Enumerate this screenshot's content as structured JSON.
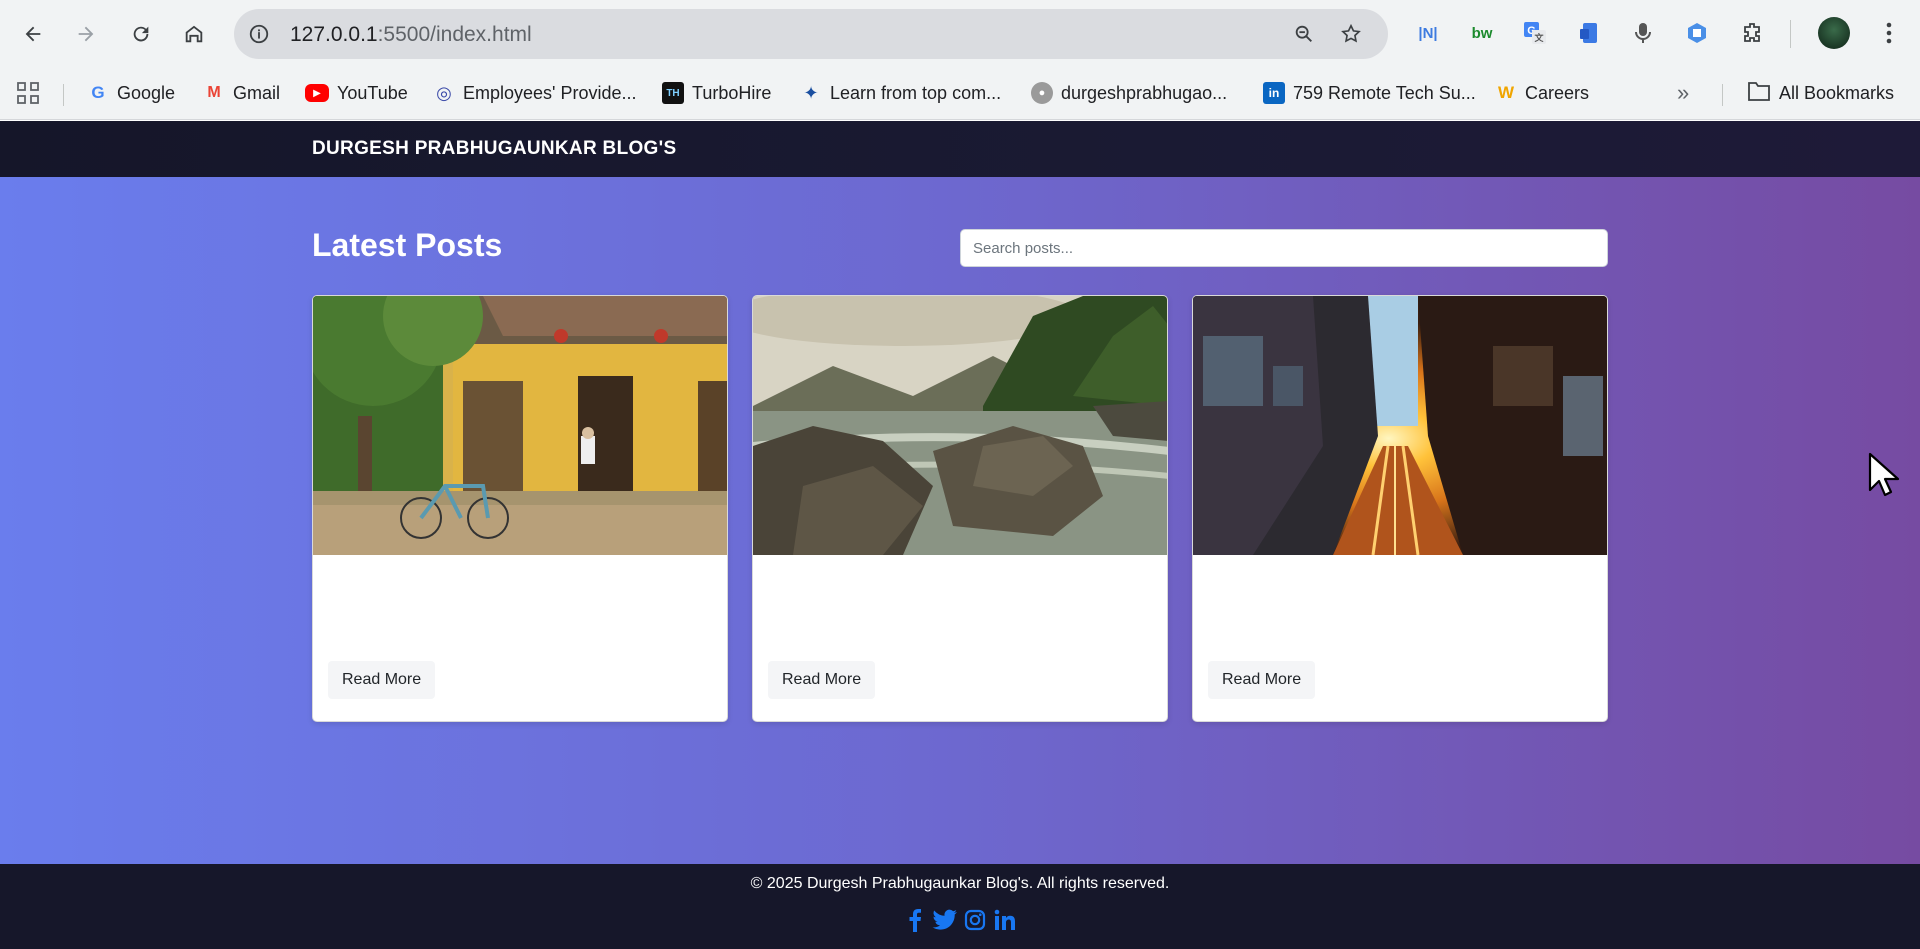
{
  "browser": {
    "url_host": "127.0.0.1",
    "url_rest": ":5500/index.html",
    "icons": [
      "back-icon",
      "forward-icon",
      "reload-icon",
      "home-icon",
      "site-info-icon",
      "zoom-icon",
      "star-icon",
      "extensions-icon",
      "menu-icon"
    ],
    "extensions": [
      {
        "name": "bars-extension-icon",
        "text": "|N|",
        "color": "#3d7be0"
      },
      {
        "name": "bw-extension-icon",
        "text": "bw",
        "color": "#1c8a2d"
      },
      {
        "name": "translate-extension-icon",
        "text": "G",
        "color": "#4285f4"
      },
      {
        "name": "doc-extension-icon",
        "text": "▮",
        "color": "#3b79e4"
      },
      {
        "name": "mic-extension-icon",
        "text": "🎙",
        "color": "#555"
      },
      {
        "name": "shield-extension-icon",
        "text": "⬡",
        "color": "#4a8fe7"
      }
    ]
  },
  "bookmarks": [
    {
      "label": "Google",
      "icon": "google-icon",
      "glyph": "G",
      "color": "#4285f4"
    },
    {
      "label": "Gmail",
      "icon": "gmail-icon",
      "glyph": "M",
      "color": "#ea4335"
    },
    {
      "label": "YouTube",
      "icon": "youtube-icon",
      "glyph": "▶",
      "color": "#ff0000"
    },
    {
      "label": "Employees' Provide...",
      "icon": "epfo-icon",
      "glyph": "◎",
      "color": "#3b4aa8"
    },
    {
      "label": "TurboHire",
      "icon": "turbohire-icon",
      "glyph": "TH",
      "color": "#111"
    },
    {
      "label": "Learn from top com...",
      "icon": "learn-icon",
      "glyph": "✦",
      "color": "#1a4fa0"
    },
    {
      "label": "durgeshprabhugao...",
      "icon": "github-icon",
      "glyph": "●",
      "color": "#888"
    },
    {
      "label": "759 Remote Tech Su...",
      "icon": "linkedin-icon",
      "glyph": "in",
      "color": "#0a66c2"
    },
    {
      "label": "Careers",
      "icon": "careers-icon",
      "glyph": "W",
      "color": "#f0a500"
    }
  ],
  "all_bookmarks": "All Bookmarks",
  "site": {
    "title": "DURGESH PRABHUGAUNKAR BLOG'S",
    "heading": "Latest Posts",
    "search_placeholder": "Search posts...",
    "posts": [
      {
        "image": "yellow-house-bicycle-photo",
        "button": "Read More"
      },
      {
        "image": "river-rocks-photo",
        "button": "Read More"
      },
      {
        "image": "street-sunset-photo",
        "button": "Read More"
      }
    ],
    "footer": "© 2025 Durgesh Prabhugaunkar Blog's. All rights reserved.",
    "social": [
      "facebook-icon",
      "twitter-icon",
      "instagram-icon",
      "linkedin-icon"
    ],
    "social_color": "#1877f2",
    "gradient": [
      "#6a7ded",
      "#764ba2"
    ]
  }
}
